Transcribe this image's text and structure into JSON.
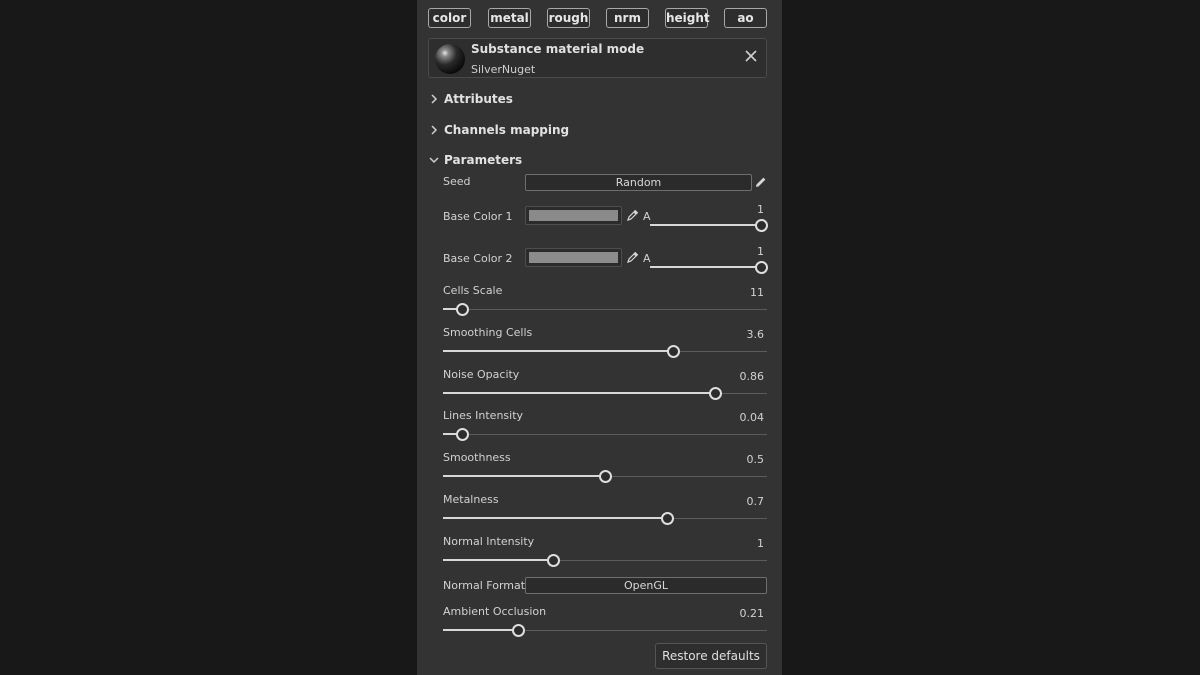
{
  "channels": [
    "color",
    "metal",
    "rough",
    "nrm",
    "height",
    "ao"
  ],
  "material": {
    "title": "Substance material mode",
    "name": "SilverNuget",
    "close_icon": "close-icon",
    "preview_icon": "material-sphere-icon"
  },
  "sections": {
    "attributes": "Attributes",
    "channels_mapping": "Channels mapping",
    "parameters": "Parameters"
  },
  "seed": {
    "label": "Seed",
    "value": "Random",
    "edit_icon": "pencil-icon"
  },
  "base_color_1": {
    "label": "Base Color 1",
    "alpha_label": "A",
    "alpha_value": "1",
    "swatch_color": "#8a8a8a",
    "picker_icon": "eyedropper-icon"
  },
  "base_color_2": {
    "label": "Base Color 2",
    "alpha_label": "A",
    "alpha_value": "1",
    "swatch_color": "#8c8c8c",
    "picker_icon": "eyedropper-icon"
  },
  "sliders": [
    {
      "id": "cells-scale",
      "label": "Cells Scale",
      "value": "11",
      "fraction": 0.06
    },
    {
      "id": "smoothing-cells",
      "label": "Smoothing Cells",
      "value": "3.6",
      "fraction": 0.71
    },
    {
      "id": "noise-opacity",
      "label": "Noise Opacity",
      "value": "0.86",
      "fraction": 0.84
    },
    {
      "id": "lines-intensity",
      "label": "Lines Intensity",
      "value": "0.04",
      "fraction": 0.06
    },
    {
      "id": "smoothness",
      "label": "Smoothness",
      "value": "0.5",
      "fraction": 0.5
    },
    {
      "id": "metalness",
      "label": "Metalness",
      "value": "0.7",
      "fraction": 0.69
    },
    {
      "id": "normal-intensity",
      "label": "Normal Intensity",
      "value": "1",
      "fraction": 0.34
    }
  ],
  "normal_format": {
    "label": "Normal Format",
    "value": "OpenGL"
  },
  "ambient_occlusion": {
    "label": "Ambient Occlusion",
    "value": "0.21",
    "fraction": 0.23
  },
  "restore_defaults": "Restore defaults",
  "colors": {
    "panel_bg": "#333333",
    "page_bg": "#181818",
    "accent": "#dedede"
  }
}
